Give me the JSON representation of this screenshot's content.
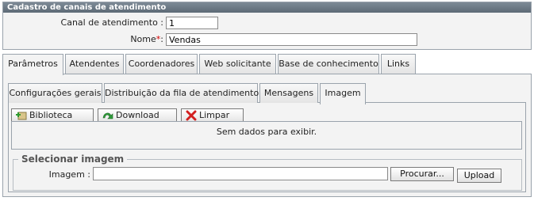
{
  "panel": {
    "title": "Cadastro de canais de atendimento",
    "canal_label": "Canal de atendimento :",
    "canal_value": "1",
    "nome_label": "Nome",
    "nome_required_mark": "*",
    "nome_colon": ":",
    "nome_value": "Vendas"
  },
  "tabs": [
    {
      "label": "Parâmetros",
      "active": true
    },
    {
      "label": "Atendentes",
      "active": false
    },
    {
      "label": "Coordenadores",
      "active": false
    },
    {
      "label": "Web solicitante",
      "active": false
    },
    {
      "label": "Base de conhecimento",
      "active": false
    },
    {
      "label": "Links",
      "active": false
    }
  ],
  "subtabs": [
    {
      "label": "Configurações gerais",
      "active": false
    },
    {
      "label": "Distribuição da fila de atendimento",
      "active": false
    },
    {
      "label": "Mensagens",
      "active": false
    },
    {
      "label": "Imagem",
      "active": true
    }
  ],
  "toolbar": {
    "biblioteca": "Biblioteca",
    "download": "Download",
    "limpar": "Limpar"
  },
  "grid": {
    "empty_text": "Sem dados para exibir."
  },
  "selecionar": {
    "legend": "Selecionar imagem",
    "imagem_label": "Imagem :",
    "imagem_value": "",
    "procurar": "Procurar...",
    "upload": "Upload"
  },
  "colors": {
    "title_bar": "#6b7884",
    "required": "#d40000",
    "border": "#9aa3ac"
  }
}
